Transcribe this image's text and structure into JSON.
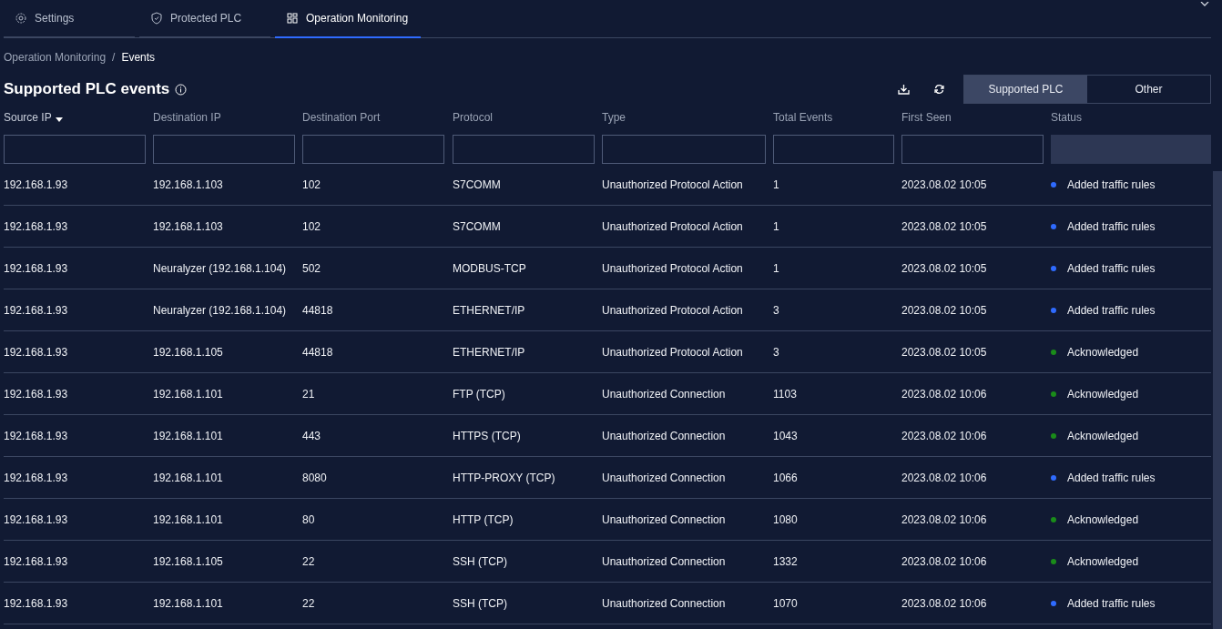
{
  "tabs": [
    {
      "label": "Settings",
      "selected": false
    },
    {
      "label": "Protected PLC",
      "selected": false
    },
    {
      "label": "Operation Monitoring",
      "selected": true
    }
  ],
  "breadcrumb": {
    "parent": "Operation Monitoring",
    "separator": "/",
    "current": "Events"
  },
  "title": "Supported PLC events",
  "segments": [
    {
      "label": "Supported PLC",
      "selected": true
    },
    {
      "label": "Other",
      "selected": false
    }
  ],
  "table": {
    "columns": [
      {
        "label": "Source IP",
        "sorted": true,
        "filter": true
      },
      {
        "label": "Destination IP",
        "sorted": false,
        "filter": true
      },
      {
        "label": "Destination Port",
        "sorted": false,
        "filter": true
      },
      {
        "label": "Protocol",
        "sorted": false,
        "filter": true
      },
      {
        "label": "Type",
        "sorted": false,
        "filter": true
      },
      {
        "label": "Total Events",
        "sorted": false,
        "filter": true
      },
      {
        "label": "First Seen",
        "sorted": false,
        "filter": true
      },
      {
        "label": "Status",
        "sorted": false,
        "filter": false
      }
    ],
    "rows": [
      {
        "cells": [
          "192.168.1.93",
          "192.168.1.103",
          "102",
          "S7COMM",
          "Unauthorized Protocol Action",
          "1",
          "2023.08.02 10:05"
        ],
        "status": "Added traffic rules",
        "color": "#2f6bff"
      },
      {
        "cells": [
          "192.168.1.93",
          "192.168.1.103",
          "102",
          "S7COMM",
          "Unauthorized Protocol Action",
          "1",
          "2023.08.02 10:05"
        ],
        "status": "Added traffic rules",
        "color": "#2f6bff"
      },
      {
        "cells": [
          "192.168.1.93",
          "Neuralyzer (192.168.1.104)",
          "502",
          "MODBUS-TCP",
          "Unauthorized Protocol Action",
          "1",
          "2023.08.02 10:05"
        ],
        "status": "Added traffic rules",
        "color": "#2f6bff"
      },
      {
        "cells": [
          "192.168.1.93",
          "Neuralyzer (192.168.1.104)",
          "44818",
          "ETHERNET/IP",
          "Unauthorized Protocol Action",
          "3",
          "2023.08.02 10:05"
        ],
        "status": "Added traffic rules",
        "color": "#2f6bff"
      },
      {
        "cells": [
          "192.168.1.93",
          "192.168.1.105",
          "44818",
          "ETHERNET/IP",
          "Unauthorized Protocol Action",
          "3",
          "2023.08.02 10:05"
        ],
        "status": "Acknowledged",
        "color": "#1a8c1a"
      },
      {
        "cells": [
          "192.168.1.93",
          "192.168.1.101",
          "21",
          "FTP (TCP)",
          "Unauthorized Connection",
          "1103",
          "2023.08.02 10:06"
        ],
        "status": "Acknowledged",
        "color": "#1a8c1a"
      },
      {
        "cells": [
          "192.168.1.93",
          "192.168.1.101",
          "443",
          "HTTPS (TCP)",
          "Unauthorized Connection",
          "1043",
          "2023.08.02 10:06"
        ],
        "status": "Acknowledged",
        "color": "#1a8c1a"
      },
      {
        "cells": [
          "192.168.1.93",
          "192.168.1.101",
          "8080",
          "HTTP-PROXY (TCP)",
          "Unauthorized Connection",
          "1066",
          "2023.08.02 10:06"
        ],
        "status": "Added traffic rules",
        "color": "#2f6bff"
      },
      {
        "cells": [
          "192.168.1.93",
          "192.168.1.101",
          "80",
          "HTTP (TCP)",
          "Unauthorized Connection",
          "1080",
          "2023.08.02 10:06"
        ],
        "status": "Acknowledged",
        "color": "#1a8c1a"
      },
      {
        "cells": [
          "192.168.1.93",
          "192.168.1.105",
          "22",
          "SSH (TCP)",
          "Unauthorized Connection",
          "1332",
          "2023.08.02 10:06"
        ],
        "status": "Acknowledged",
        "color": "#1a8c1a"
      },
      {
        "cells": [
          "192.168.1.93",
          "192.168.1.101",
          "22",
          "SSH (TCP)",
          "Unauthorized Connection",
          "1070",
          "2023.08.02 10:06"
        ],
        "status": "Added traffic rules",
        "color": "#2f6bff"
      }
    ]
  }
}
